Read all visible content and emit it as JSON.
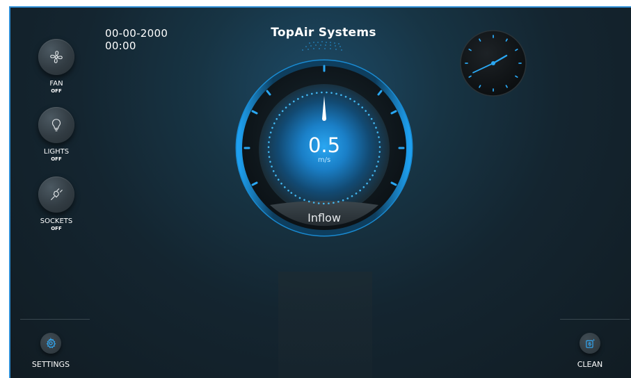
{
  "header": {
    "date": "00-00-2000",
    "time": "00:00",
    "brand": "TopAir Systems"
  },
  "sidebar": {
    "items": [
      {
        "label": "FAN",
        "state": "OFF",
        "icon": "fan-icon"
      },
      {
        "label": "LIGHTS",
        "state": "OFF",
        "icon": "lightbulb-icon"
      },
      {
        "label": "SOCKETS",
        "state": "OFF",
        "icon": "plug-icon"
      }
    ]
  },
  "gauge": {
    "value": "0.5",
    "unit": "m/s",
    "label": "Inflow"
  },
  "clock": {
    "hour_hand_angle_deg": 60,
    "minute_hand_angle_deg": 245
  },
  "footer": {
    "settings_label": "SETTINGS",
    "settings_icon": "gear-icon",
    "clean_label": "CLEAN",
    "clean_icon": "clean-icon"
  },
  "colors": {
    "accent": "#2f8fd6",
    "gauge_glow": "#1f9be6",
    "text": "#ffffff",
    "background": "#142530"
  }
}
